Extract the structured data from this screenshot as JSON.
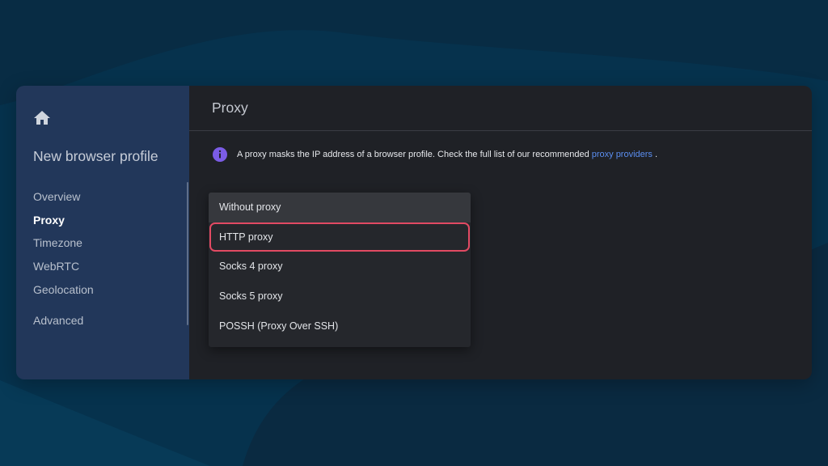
{
  "colors": {
    "background": "#06324d",
    "sidebar": "#22375a",
    "content": "#1f2126",
    "link": "#5b8ef0",
    "info_icon": "#7b5ce6",
    "highlight_border": "#e24a63"
  },
  "sidebar": {
    "home_icon": "home-icon",
    "profile_title": "New browser profile",
    "items": [
      {
        "label": "Overview",
        "active": false
      },
      {
        "label": "Proxy",
        "active": true
      },
      {
        "label": "Timezone",
        "active": false
      },
      {
        "label": "WebRTC",
        "active": false
      },
      {
        "label": "Geolocation",
        "active": false
      }
    ],
    "advanced_label": "Advanced"
  },
  "main": {
    "title": "Proxy",
    "info": {
      "icon": "info-icon",
      "text": "A proxy masks the IP address of a browser profile. Check the full list of our recommended",
      "link_text": "proxy providers",
      "text_end": "."
    },
    "proxy_dropdown": {
      "selected_value": "Without proxy",
      "highlighted_option": "HTTP proxy",
      "options": [
        "Without proxy",
        "HTTP proxy",
        "Socks 4 proxy",
        "Socks 5 proxy",
        "POSSH (Proxy Over SSH)"
      ]
    }
  }
}
